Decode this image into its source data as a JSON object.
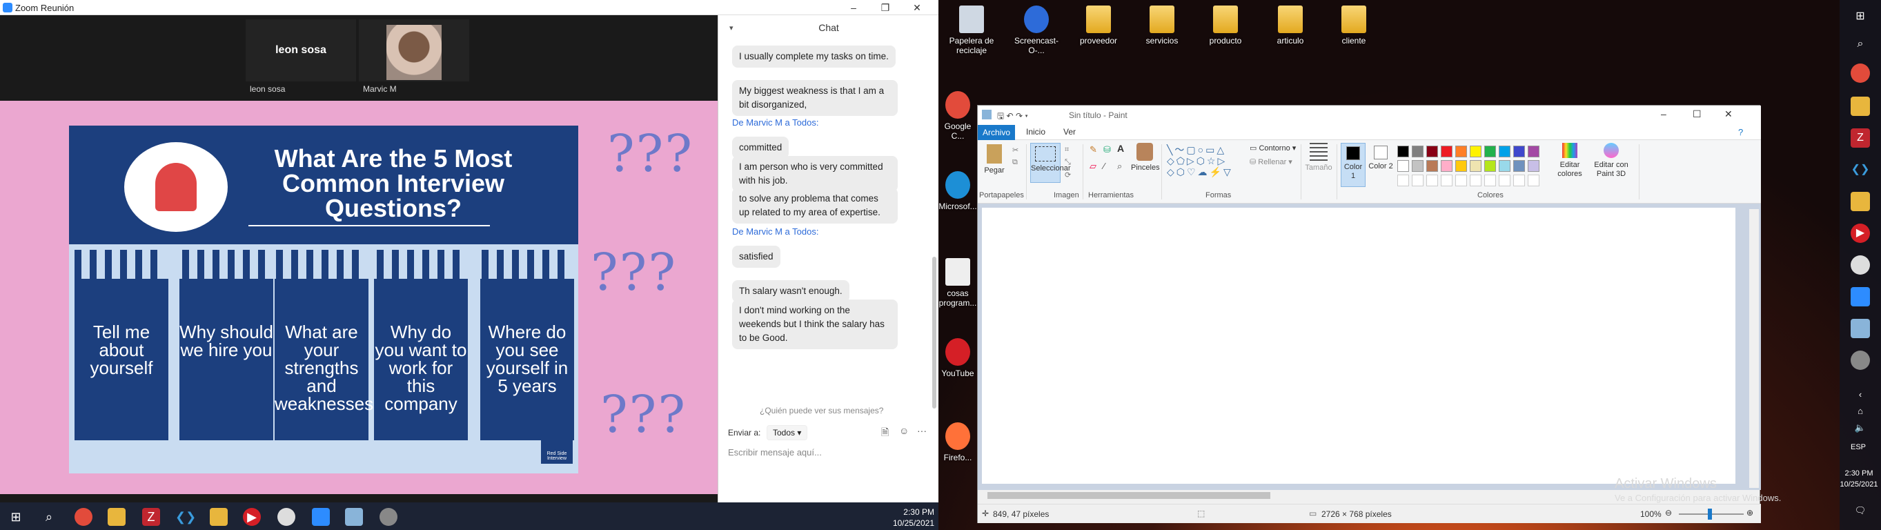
{
  "zoom": {
    "window_title": "Zoom Reunión",
    "participants": [
      {
        "tile_name": "leon sosa",
        "caption": "leon sosa"
      },
      {
        "tile_name": "",
        "caption": "Marvic M"
      }
    ],
    "slide": {
      "title": "What Are the 5 Most Common Interview Questions?",
      "cards": [
        "Tell me about yourself",
        "Why should we hire you",
        "What are your strengths and weaknesses",
        "Why do you want to work for this company",
        "Where do you see yourself in 5 years"
      ],
      "logo_text": "Red Side Interview"
    },
    "chat": {
      "header": "Chat",
      "messages": [
        {
          "type": "bubble",
          "text": "I usually complete my tasks on time."
        },
        {
          "type": "bubble",
          "text": "My biggest weakness is that I am a bit disorganized,"
        },
        {
          "type": "from",
          "text": "De Marvic M a Todos:"
        },
        {
          "type": "bubble",
          "text": "committed"
        },
        {
          "type": "bubble",
          "text": "I am person who is very committed with his job."
        },
        {
          "type": "bubble",
          "text": "to solve any problema that comes up related to my area of expertise."
        },
        {
          "type": "from",
          "text": "De Marvic M a Todos:"
        },
        {
          "type": "bubble",
          "text": "satisfied"
        },
        {
          "type": "bubble",
          "text": "Th salary wasn't enough."
        },
        {
          "type": "bubble",
          "text": "I don't mind working on the weekends but I think the salary has to be Good."
        }
      ],
      "privacy_link": "¿Quién puede ver sus mensajes?",
      "send_to_label": "Enviar a:",
      "send_to_value": "Todos",
      "input_placeholder": "Escribir mensaje aquí..."
    }
  },
  "left_taskbar": {
    "clock_time": "2:30 PM",
    "clock_date": "10/25/2021"
  },
  "desktop": {
    "icons_top": [
      "Papelera de reciclaje",
      "Screencast-O-...",
      "proveedor",
      "servicios",
      "producto",
      "articulo",
      "cliente"
    ],
    "icons_left": [
      "Google C...",
      "Microsof...",
      "cosas program...",
      "YouTube",
      "Firefo..."
    ]
  },
  "paint": {
    "title": "Sin título - Paint",
    "tabs": [
      "Archivo",
      "Inicio",
      "Ver"
    ],
    "ribbon": {
      "paste": "Pegar",
      "select": "Seleccionar",
      "brushes": "Pinceles",
      "outline": "Contorno",
      "fill": "Rellenar",
      "size": "Tamaño",
      "color1": "Color 1",
      "color2": "Color 2",
      "edit_colors": "Editar colores",
      "paint3d": "Editar con Paint 3D",
      "groups": [
        "Portapapeles",
        "Imagen",
        "Herramientas",
        "Formas",
        "Colores"
      ]
    },
    "palette": [
      "#000000",
      "#7f7f7f",
      "#880015",
      "#ed1c24",
      "#ff7f27",
      "#fff200",
      "#22b14c",
      "#00a2e8",
      "#3f48cc",
      "#a349a4",
      "#ffffff",
      "#c3c3c3",
      "#b97a57",
      "#ffaec9",
      "#ffc90e",
      "#efe4b0",
      "#b5e61d",
      "#99d9ea",
      "#7092be",
      "#c8bfe7"
    ],
    "status": {
      "cursor": "849, 47 píxeles",
      "size": "2726 × 768 píxeles",
      "zoom": "100%"
    }
  },
  "watermark": {
    "title": "Activar Windows",
    "sub": "Ve a Configuración para activar Windows."
  },
  "right_taskbar": {
    "lang": "ESP",
    "clock_time": "2:30 PM",
    "clock_date": "10/25/2021"
  }
}
